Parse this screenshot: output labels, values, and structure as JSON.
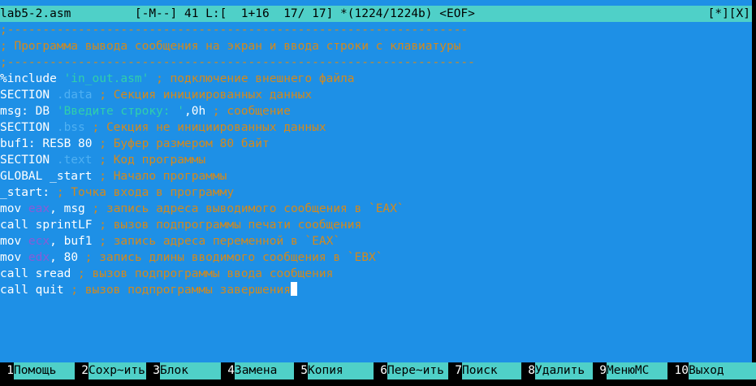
{
  "titlebar": {
    "left": "lab5-2.asm         [-M--] 41 L:[  1+16  17/ 17] *(1224/1224b) <EOF>",
    "right": "[*][X]"
  },
  "editor_lines": [
    [
      {
        "t": ";-----------------------------------------------------------------",
        "c": "comment"
      }
    ],
    [
      {
        "t": "; Программа вывода сообщения на экран и ввода строки с клавиатуры",
        "c": "comment"
      }
    ],
    [
      {
        "t": ";------------------------------------------------------------------",
        "c": "comment"
      }
    ],
    [
      {
        "t": "%include ",
        "c": "white"
      },
      {
        "t": "'in_out.asm'",
        "c": "string"
      },
      {
        "t": " ; подключение внешнего файла",
        "c": "comment"
      }
    ],
    [
      {
        "t": "SECTION ",
        "c": "white"
      },
      {
        "t": ".data",
        "c": "dim"
      },
      {
        "t": " ; Секция инициированных данных",
        "c": "comment"
      }
    ],
    [
      {
        "t": "msg: DB ",
        "c": "white"
      },
      {
        "t": "'Введите строку: '",
        "c": "string"
      },
      {
        "t": ",0h",
        "c": "white"
      },
      {
        "t": " ; сообщение",
        "c": "comment"
      }
    ],
    [
      {
        "t": "SECTION ",
        "c": "white"
      },
      {
        "t": ".bss",
        "c": "dim"
      },
      {
        "t": " ; Секция не инициированных данных",
        "c": "comment"
      }
    ],
    [
      {
        "t": "buf1: RESB 80",
        "c": "white"
      },
      {
        "t": " ; Буфер размером 80 байт",
        "c": "comment"
      }
    ],
    [
      {
        "t": "SECTION ",
        "c": "white"
      },
      {
        "t": ".text",
        "c": "dim"
      },
      {
        "t": " ; Код программы",
        "c": "comment"
      }
    ],
    [
      {
        "t": "GLOBAL _start",
        "c": "white"
      },
      {
        "t": " ; Начало программы",
        "c": "comment"
      }
    ],
    [
      {
        "t": "_start:",
        "c": "white"
      },
      {
        "t": " ; Точка входа в программу",
        "c": "comment"
      }
    ],
    [
      {
        "t": "mov ",
        "c": "white"
      },
      {
        "t": "eax",
        "c": "reg"
      },
      {
        "t": ", msg",
        "c": "white"
      },
      {
        "t": " ; запись адреса выводимого сообщения в `EAX`",
        "c": "comment"
      }
    ],
    [
      {
        "t": "call sprintLF",
        "c": "white"
      },
      {
        "t": " ; вызов подпрограммы печати сообщения",
        "c": "comment"
      }
    ],
    [
      {
        "t": "mov ",
        "c": "white"
      },
      {
        "t": "ecx",
        "c": "reg"
      },
      {
        "t": ", buf1",
        "c": "white"
      },
      {
        "t": " ; запись адреса переменной в `EAX`",
        "c": "comment"
      }
    ],
    [
      {
        "t": "mov ",
        "c": "white"
      },
      {
        "t": "edx",
        "c": "reg"
      },
      {
        "t": ", 80",
        "c": "white"
      },
      {
        "t": " ; запись длины вводимого сообщения в `EBX`",
        "c": "comment"
      }
    ],
    [
      {
        "t": "call sread",
        "c": "white"
      },
      {
        "t": " ; вызов подпрограммы ввода сообщения",
        "c": "comment"
      }
    ],
    [
      {
        "t": "call quit",
        "c": "white"
      },
      {
        "t": " ; вызов подпрограммы завершения",
        "c": "comment"
      }
    ]
  ],
  "cursor_line": 16,
  "function_keys": [
    {
      "num": "1",
      "label": "Помощь",
      "name": "help"
    },
    {
      "num": "2",
      "label": "Сохр~ить",
      "name": "save"
    },
    {
      "num": "3",
      "label": "Блок",
      "name": "block"
    },
    {
      "num": "4",
      "label": "Замена",
      "name": "replace"
    },
    {
      "num": "5",
      "label": "Копия",
      "name": "copy"
    },
    {
      "num": "6",
      "label": "Пере~ить",
      "name": "move"
    },
    {
      "num": "7",
      "label": "Поиск",
      "name": "search"
    },
    {
      "num": "8",
      "label": "Удалить",
      "name": "delete"
    },
    {
      "num": "9",
      "label": "МенюMC",
      "name": "menu"
    },
    {
      "num": "10",
      "label": "Выход",
      "name": "quit"
    }
  ],
  "colors": {
    "editor_background": "#1e90e6",
    "title_background": "#4fd0c8",
    "comment": "#d4891c",
    "string": "#30cfaa",
    "section_name": "#4fb0f2",
    "register": "#8a5bd6"
  }
}
